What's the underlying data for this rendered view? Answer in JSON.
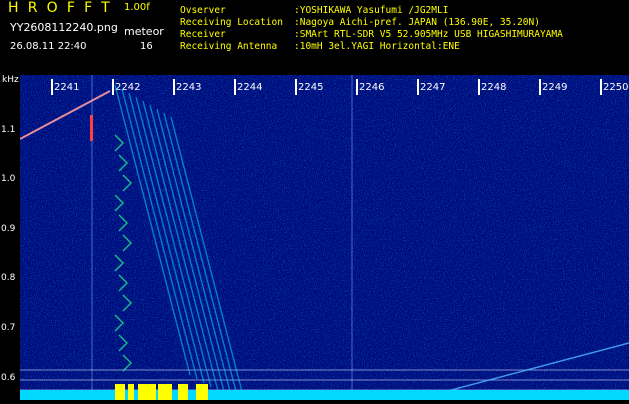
{
  "header": {
    "logo": "HROFFT",
    "version": "1.00f",
    "filename": "YY2608112240.png",
    "mode_label": "meteor",
    "timestamp": "26.08.11 22:40",
    "meteor_count": "16"
  },
  "info": [
    {
      "label": "Ovserver",
      "value": ":YOSHIKAWA Yasufumi /JG2MLI"
    },
    {
      "label": "Receiving Location",
      "value": ":Nagoya Aichi-pref. JAPAN (136.90E, 35.20N)"
    },
    {
      "label": "Receiver",
      "value": ":SMArt RTL-SDR V5 52.905MHz USB HIGASHIMURAYAMA"
    },
    {
      "label": "Receiving Antenna",
      "value": ":10mH 3el.YAGI Horizontal:ENE"
    }
  ],
  "axis": {
    "y_unit": "kHz",
    "y_ticks": [
      "1.1",
      "1.0",
      "0.9",
      "0.8",
      "0.7",
      "0.6"
    ],
    "x_ticks": [
      "2241",
      "2242",
      "2243",
      "2244",
      "2245",
      "2246",
      "2247",
      "2248",
      "2249",
      "2250"
    ]
  },
  "colors": {
    "background": "#000000",
    "spectrum_base": "#000a78",
    "signal_cyan": "#00e0ff",
    "signal_yellow": "#ffff00",
    "header_text": "#ffff00"
  }
}
